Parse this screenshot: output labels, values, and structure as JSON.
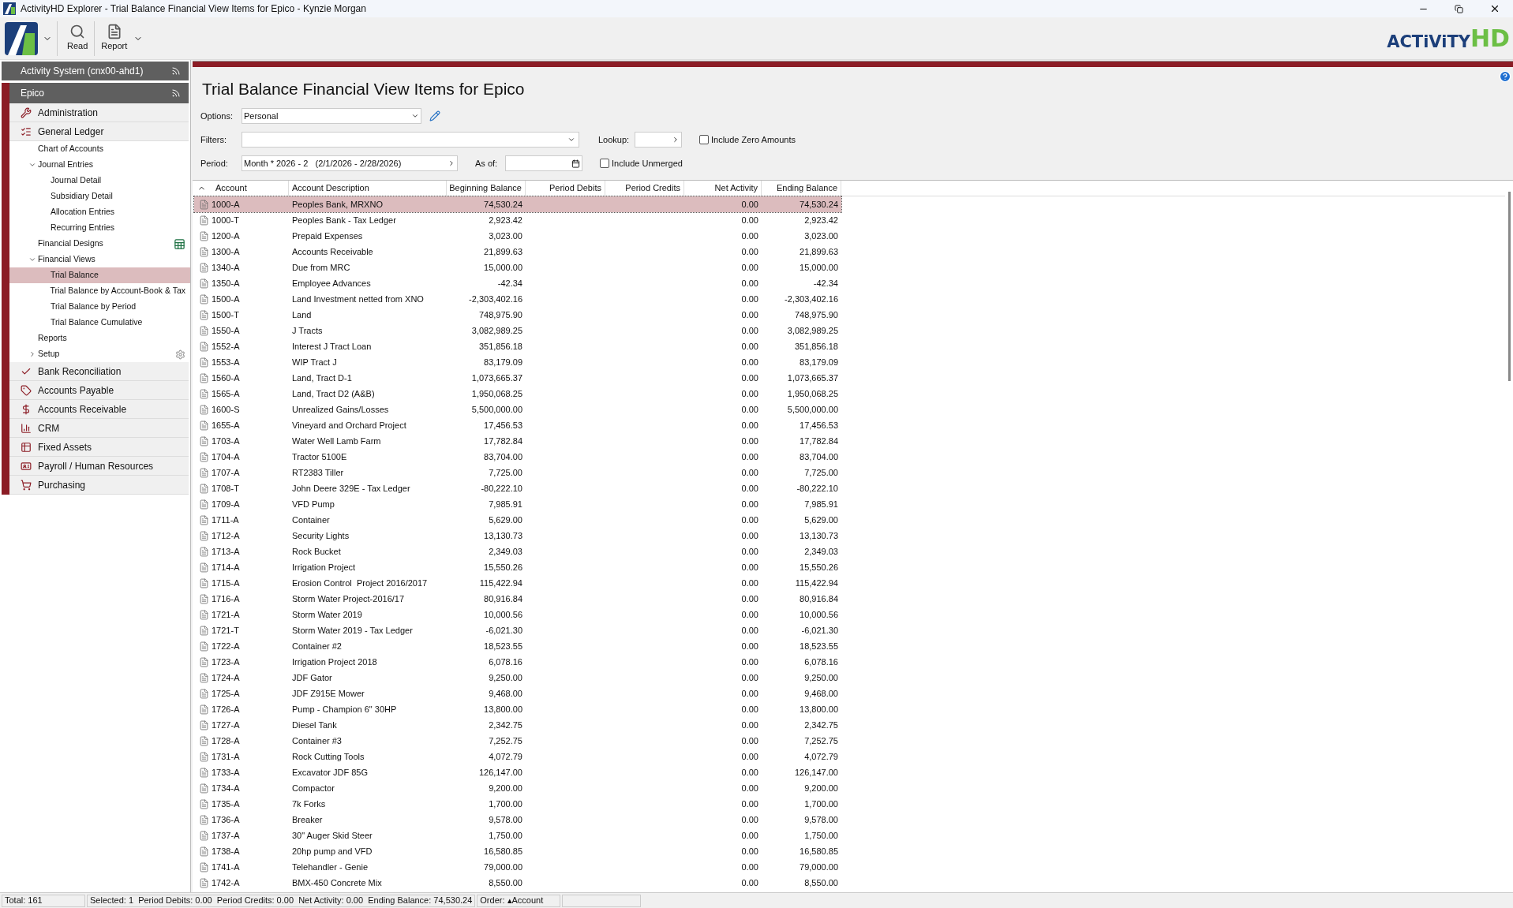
{
  "window": {
    "title": "ActivityHD Explorer - Trial Balance Financial View Items for Epico - Kynzie Morgan"
  },
  "toolbar": {
    "buttons": [
      {
        "label": "Read"
      },
      {
        "label": "Report"
      }
    ],
    "brand": [
      "ACTiViTY",
      "HD"
    ]
  },
  "sidebar": {
    "system": "Activity System (cnx00-ahd1)",
    "company": "Epico",
    "modules": [
      {
        "label": "Administration"
      },
      {
        "label": "General Ledger",
        "children": [
          {
            "label": "Chart of Accounts",
            "selected": false
          },
          {
            "label": "Journal Entries",
            "selected": false,
            "expanded": true,
            "children": [
              {
                "label": "Journal Detail",
                "selected": false
              },
              {
                "label": "Subsidiary Detail",
                "selected": false
              },
              {
                "label": "Allocation Entries",
                "selected": false
              },
              {
                "label": "Recurring Entries",
                "selected": false
              }
            ]
          },
          {
            "label": "Financial Designs",
            "selected": false,
            "kind": "spreadsheet"
          },
          {
            "label": "Financial Views",
            "selected": false,
            "expanded": true,
            "children": [
              {
                "label": "Trial Balance",
                "selected": true
              },
              {
                "label": "Trial Balance by Account-Book & Tax",
                "selected": false
              },
              {
                "label": "Trial Balance by Period",
                "selected": false
              },
              {
                "label": "Trial Balance Cumulative",
                "selected": false
              }
            ]
          },
          {
            "label": "Reports",
            "selected": false
          },
          {
            "label": "Setup",
            "selected": false,
            "expanded": false,
            "kind": "settings"
          }
        ]
      },
      {
        "label": "Bank Reconciliation"
      },
      {
        "label": "Accounts Payable"
      },
      {
        "label": "Accounts Receivable"
      },
      {
        "label": "CRM"
      },
      {
        "label": "Fixed Assets"
      },
      {
        "label": "Payroll / Human Resources"
      },
      {
        "label": "Purchasing"
      }
    ]
  },
  "page": {
    "title": "Trial Balance Financial View Items for Epico"
  },
  "form": {
    "options": {
      "label": "Options:",
      "value": "Personal"
    },
    "filters": {
      "label": "Filters:"
    },
    "lookup": {
      "label": "Lookup:"
    },
    "include_zero": {
      "label": "Include Zero Amounts",
      "checked": false
    },
    "period": {
      "label": "Period:",
      "value": "Month * 2026 - 2   (2/1/2026 - 2/28/2026)"
    },
    "as_of": {
      "label": "As of:"
    },
    "include_unmerged": {
      "label": "Include Unmerged",
      "checked": false
    }
  },
  "table": {
    "columns": [
      {
        "label": "Account",
        "sorted": true
      },
      {
        "label": "Account Description",
        "sorted": false
      },
      {
        "label": "Beginning Balance",
        "sorted": false
      },
      {
        "label": "Period Debits",
        "sorted": false
      },
      {
        "label": "Period Credits",
        "sorted": false
      },
      {
        "label": "Net Activity",
        "sorted": false
      },
      {
        "label": "Ending Balance",
        "sorted": false
      }
    ],
    "rows": [
      {
        "account": "1000-A",
        "description": "Peoples Bank, MRXNO",
        "beginning": "74,530.24",
        "net": "0.00",
        "ending": "74,530.24",
        "selected": true
      },
      {
        "account": "1000-T",
        "description": "Peoples Bank - Tax Ledger",
        "beginning": "2,923.42",
        "net": "0.00",
        "ending": "2,923.42",
        "selected": false
      },
      {
        "account": "1200-A",
        "description": "Prepaid Expenses",
        "beginning": "3,023.00",
        "net": "0.00",
        "ending": "3,023.00",
        "selected": false
      },
      {
        "account": "1300-A",
        "description": "Accounts Receivable",
        "beginning": "21,899.63",
        "net": "0.00",
        "ending": "21,899.63",
        "selected": false
      },
      {
        "account": "1340-A",
        "description": "Due from MRC",
        "beginning": "15,000.00",
        "net": "0.00",
        "ending": "15,000.00",
        "selected": false
      },
      {
        "account": "1350-A",
        "description": "Employee Advances",
        "beginning": "-42.34",
        "net": "0.00",
        "ending": "-42.34",
        "selected": false
      },
      {
        "account": "1500-A",
        "description": "Land Investment netted from XNO",
        "beginning": "-2,303,402.16",
        "net": "0.00",
        "ending": "-2,303,402.16",
        "selected": false
      },
      {
        "account": "1500-T",
        "description": "Land",
        "beginning": "748,975.90",
        "net": "0.00",
        "ending": "748,975.90",
        "selected": false
      },
      {
        "account": "1550-A",
        "description": "J Tracts",
        "beginning": "3,082,989.25",
        "net": "0.00",
        "ending": "3,082,989.25",
        "selected": false
      },
      {
        "account": "1552-A",
        "description": "Interest J Tract Loan",
        "beginning": "351,856.18",
        "net": "0.00",
        "ending": "351,856.18",
        "selected": false
      },
      {
        "account": "1553-A",
        "description": "WIP Tract J",
        "beginning": "83,179.09",
        "net": "0.00",
        "ending": "83,179.09",
        "selected": false
      },
      {
        "account": "1560-A",
        "description": "Land, Tract D-1",
        "beginning": "1,073,665.37",
        "net": "0.00",
        "ending": "1,073,665.37",
        "selected": false
      },
      {
        "account": "1565-A",
        "description": "Land, Tract D2 (A&B)",
        "beginning": "1,950,068.25",
        "net": "0.00",
        "ending": "1,950,068.25",
        "selected": false
      },
      {
        "account": "1600-S",
        "description": "Unrealized Gains/Losses",
        "beginning": "5,500,000.00",
        "net": "0.00",
        "ending": "5,500,000.00",
        "selected": false
      },
      {
        "account": "1655-A",
        "description": "Vineyard and Orchard Project",
        "beginning": "17,456.53",
        "net": "0.00",
        "ending": "17,456.53",
        "selected": false
      },
      {
        "account": "1703-A",
        "description": "Water Well Lamb Farm",
        "beginning": "17,782.84",
        "net": "0.00",
        "ending": "17,782.84",
        "selected": false
      },
      {
        "account": "1704-A",
        "description": "Tractor 5100E",
        "beginning": "83,704.00",
        "net": "0.00",
        "ending": "83,704.00",
        "selected": false
      },
      {
        "account": "1707-A",
        "description": "RT2383 Tiller",
        "beginning": "7,725.00",
        "net": "0.00",
        "ending": "7,725.00",
        "selected": false
      },
      {
        "account": "1708-T",
        "description": "John Deere 329E - Tax Ledger",
        "beginning": "-80,222.10",
        "net": "0.00",
        "ending": "-80,222.10",
        "selected": false
      },
      {
        "account": "1709-A",
        "description": "VFD Pump",
        "beginning": "7,985.91",
        "net": "0.00",
        "ending": "7,985.91",
        "selected": false
      },
      {
        "account": "1711-A",
        "description": "Container",
        "beginning": "5,629.00",
        "net": "0.00",
        "ending": "5,629.00",
        "selected": false
      },
      {
        "account": "1712-A",
        "description": "Security Lights",
        "beginning": "13,130.73",
        "net": "0.00",
        "ending": "13,130.73",
        "selected": false
      },
      {
        "account": "1713-A",
        "description": "Rock Bucket",
        "beginning": "2,349.03",
        "net": "0.00",
        "ending": "2,349.03",
        "selected": false
      },
      {
        "account": "1714-A",
        "description": "Irrigation Project",
        "beginning": "15,550.26",
        "net": "0.00",
        "ending": "15,550.26",
        "selected": false
      },
      {
        "account": "1715-A",
        "description": "Erosion Control  Project 2016/2017",
        "beginning": "115,422.94",
        "net": "0.00",
        "ending": "115,422.94",
        "selected": false
      },
      {
        "account": "1716-A",
        "description": "Storm Water Project-2016/17",
        "beginning": "80,916.84",
        "net": "0.00",
        "ending": "80,916.84",
        "selected": false
      },
      {
        "account": "1721-A",
        "description": "Storm Water 2019",
        "beginning": "10,000.56",
        "net": "0.00",
        "ending": "10,000.56",
        "selected": false
      },
      {
        "account": "1721-T",
        "description": "Storm Water 2019 - Tax Ledger",
        "beginning": "-6,021.30",
        "net": "0.00",
        "ending": "-6,021.30",
        "selected": false
      },
      {
        "account": "1722-A",
        "description": "Container #2",
        "beginning": "18,523.55",
        "net": "0.00",
        "ending": "18,523.55",
        "selected": false
      },
      {
        "account": "1723-A",
        "description": "Irrigation Project 2018",
        "beginning": "6,078.16",
        "net": "0.00",
        "ending": "6,078.16",
        "selected": false
      },
      {
        "account": "1724-A",
        "description": "JDF Gator",
        "beginning": "9,250.00",
        "net": "0.00",
        "ending": "9,250.00",
        "selected": false
      },
      {
        "account": "1725-A",
        "description": "JDF Z915E Mower",
        "beginning": "9,468.00",
        "net": "0.00",
        "ending": "9,468.00",
        "selected": false
      },
      {
        "account": "1726-A",
        "description": "Pump - Champion 6\" 30HP",
        "beginning": "13,800.00",
        "net": "0.00",
        "ending": "13,800.00",
        "selected": false
      },
      {
        "account": "1727-A",
        "description": "Diesel Tank",
        "beginning": "2,342.75",
        "net": "0.00",
        "ending": "2,342.75",
        "selected": false
      },
      {
        "account": "1728-A",
        "description": "Container #3",
        "beginning": "7,252.75",
        "net": "0.00",
        "ending": "7,252.75",
        "selected": false
      },
      {
        "account": "1731-A",
        "description": "Rock Cutting Tools",
        "beginning": "4,072.79",
        "net": "0.00",
        "ending": "4,072.79",
        "selected": false
      },
      {
        "account": "1733-A",
        "description": "Excavator JDF 85G",
        "beginning": "126,147.00",
        "net": "0.00",
        "ending": "126,147.00",
        "selected": false
      },
      {
        "account": "1734-A",
        "description": "Compactor",
        "beginning": "9,200.00",
        "net": "0.00",
        "ending": "9,200.00",
        "selected": false
      },
      {
        "account": "1735-A",
        "description": "7k Forks",
        "beginning": "1,700.00",
        "net": "0.00",
        "ending": "1,700.00",
        "selected": false
      },
      {
        "account": "1736-A",
        "description": "Breaker",
        "beginning": "9,578.00",
        "net": "0.00",
        "ending": "9,578.00",
        "selected": false
      },
      {
        "account": "1737-A",
        "description": "30\" Auger Skid Steer",
        "beginning": "1,750.00",
        "net": "0.00",
        "ending": "1,750.00",
        "selected": false
      },
      {
        "account": "1738-A",
        "description": "20hp pump and VFD",
        "beginning": "16,580.85",
        "net": "0.00",
        "ending": "16,580.85",
        "selected": false
      },
      {
        "account": "1741-A",
        "description": "Telehandler - Genie",
        "beginning": "79,000.00",
        "net": "0.00",
        "ending": "79,000.00",
        "selected": false
      },
      {
        "account": "1742-A",
        "description": "BMX-450 Concrete Mix",
        "beginning": "8,550.00",
        "net": "0.00",
        "ending": "8,550.00",
        "selected": false
      }
    ]
  },
  "status_bar": [
    "Total: 161",
    "Selected: 1  Period Debits: 0.00  Period Credits: 0.00  Net Activity: 0.00  Ending Balance: 74,530.24",
    "Order: ▴Account"
  ]
}
